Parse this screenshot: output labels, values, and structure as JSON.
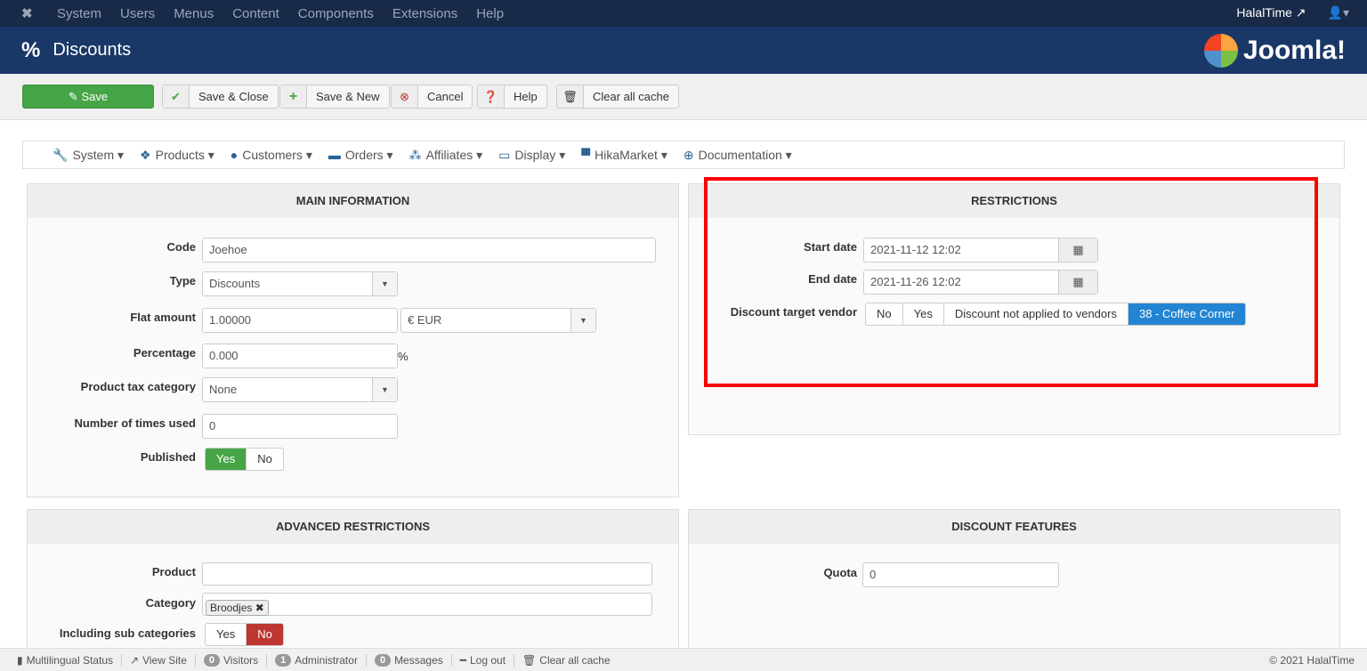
{
  "topbar": {
    "menus": [
      "System",
      "Users",
      "Menus",
      "Content",
      "Components",
      "Extensions",
      "Help"
    ],
    "site": "HalalTime"
  },
  "header": {
    "title": "Discounts",
    "logo": "Joomla!"
  },
  "toolbar": {
    "save": "Save",
    "save_close": "Save & Close",
    "save_new": "Save & New",
    "cancel": "Cancel",
    "help": "Help",
    "clear_cache": "Clear all cache"
  },
  "submenu": [
    "System",
    "Products",
    "Customers",
    "Orders",
    "Affiliates",
    "Display",
    "HikaMarket",
    "Documentation"
  ],
  "main": {
    "title": "MAIN INFORMATION",
    "code_label": "Code",
    "code": "Joehoe",
    "type_label": "Type",
    "type": "Discounts",
    "flat_label": "Flat amount",
    "flat": "1.00000",
    "currency": "€ EUR",
    "pct_label": "Percentage",
    "pct": "0.000",
    "pct_unit": "%",
    "tax_label": "Product tax category",
    "tax": "None",
    "used_label": "Number of times used",
    "used": "0",
    "published_label": "Published",
    "yes": "Yes",
    "no": "No"
  },
  "restrictions": {
    "title": "RESTRICTIONS",
    "start_label": "Start date",
    "start": "2021-11-12 12:02",
    "end_label": "End date",
    "end": "2021-11-26 12:02",
    "vendor_label": "Discount target vendor",
    "opts": [
      "No",
      "Yes",
      "Discount not applied to vendors",
      "38 - Coffee Corner"
    ]
  },
  "advanced": {
    "title": "ADVANCED RESTRICTIONS",
    "product_label": "Product",
    "category_label": "Category",
    "category_tag": "Broodjes",
    "sub_label": "Including sub categories",
    "yes": "Yes",
    "no": "No"
  },
  "features": {
    "title": "DISCOUNT FEATURES",
    "quota_label": "Quota",
    "quota": "0"
  },
  "status": {
    "multilingual": "Multilingual Status",
    "view_site": "View Site",
    "visitors_count": "0",
    "visitors": "Visitors",
    "admin_count": "1",
    "admin": "Administrator",
    "messages_count": "0",
    "messages": "Messages",
    "logout": "Log out",
    "clear_cache": "Clear all cache",
    "copyright": "© 2021 HalalTime"
  }
}
